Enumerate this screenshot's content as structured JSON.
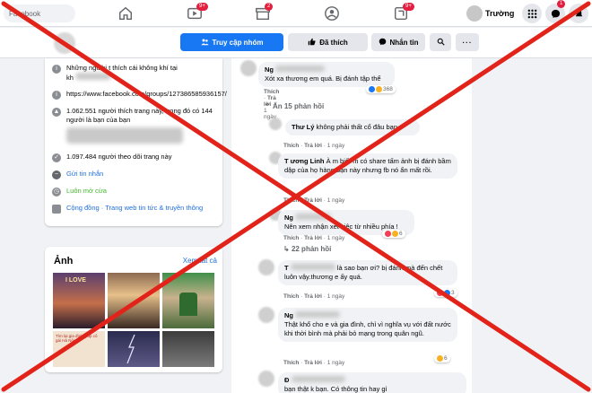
{
  "topnav": {
    "search_placeholder": "Facebook",
    "watch_badge": "9+",
    "market_badge": "2",
    "gaming_badge": "9+",
    "user_name": "Trường",
    "messenger_badge": "1"
  },
  "group_bar": {
    "visit_group": "Truy cập nhóm",
    "like": "Đã thích",
    "message": "Nhắn tin"
  },
  "about": {
    "row1": "Những người t  thích cái không khí tại",
    "row1b": "kh",
    "url": "https://www.facebook.com/groups/127386585936157/",
    "likes": "1.062.551 người thích trang này, trong đó có 144 người là bạn của bạn",
    "follows": "1.097.484 người theo dõi trang này",
    "send_message": "Gửi tin nhắn",
    "open": "Luôn mở cửa",
    "category": "Cộng đồng · Trang web tin tức & truyền thông"
  },
  "photos": {
    "title": "Ảnh",
    "see_all": "Xem tất cả",
    "thumb_text_1": "I LOVE",
    "thumb_text_2": "Tìm lại gia đình giúp cô gái Hà Nội"
  },
  "comments": {
    "c0_text": "Xót xa thương em quá. Bị đánh tập thể",
    "c0_who": "Ng",
    "c0_count": "368",
    "hide_replies": "Ẩn 15 phản hồi",
    "r1_who": "Thư Lý",
    "r1_text": "không phải thất cổ đâu bạn",
    "r2_who": "T  ương Linh",
    "r2_text": "À m biết m có share tấm ảnh bị đánh bầm dập của họ hàng bạn này nhưng fb nó ẩn mất rồi.",
    "r3_who": "Ng",
    "r3_text": "Nên xem nhận xét việc từ nhiều phía !",
    "r3_count": "6",
    "replies_22": "22 phản hồi",
    "c4_who": "T",
    "c4_text": "là sao bạn ơi? bị đánh mà đến chết luôn vậy.thương e ấy quá.",
    "c4_count": "3",
    "c5_who": "Ng",
    "c5_text": "Thật khổ cho e và gia đình, chỉ vì nghĩa vụ với đất nước khi thời bình mà phải bỏ mạng trong quân ngũ.",
    "c5_count": "6",
    "c6_who": "Đ",
    "c6_text": "bạn thật k bạn. Có thông tin hay gì",
    "like_label": "Thích",
    "reply_label": "Trả lời",
    "time": "1 ngày"
  },
  "colors": {
    "accent": "#1877f2",
    "cross": "#e2231a"
  }
}
